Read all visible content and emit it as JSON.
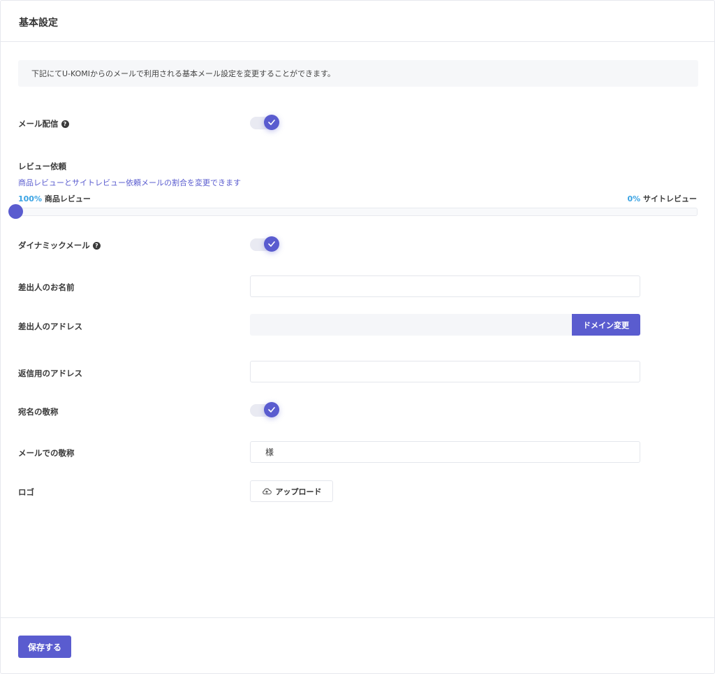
{
  "header": {
    "title": "基本設定"
  },
  "notice": {
    "text": "下記にてU-KOMIからのメールで利用される基本メール設定を変更することができます。"
  },
  "mail_delivery": {
    "label": "メール配信",
    "help_icon": "question-circle-icon",
    "enabled": true
  },
  "review_request": {
    "label": "レビュー依頼",
    "description": "商品レビューとサイトレビュー依頼メールの割合を変更できます",
    "product_percent": "100%",
    "product_label": "商品レビュー",
    "site_percent": "0%",
    "site_label": "サイトレビュー",
    "slider_value": 1.0
  },
  "dynamic_mail": {
    "label": "ダイナミックメール",
    "help_icon": "question-circle-icon",
    "enabled": true
  },
  "sender_name": {
    "label": "差出人のお名前",
    "value": "",
    "placeholder": ""
  },
  "sender_address": {
    "label": "差出人のアドレス",
    "value": "",
    "domain_button": "ドメイン変更"
  },
  "reply_address": {
    "label": "返信用のアドレス",
    "value": "",
    "placeholder": ""
  },
  "honorific_toggle": {
    "label": "宛名の敬称",
    "enabled": true
  },
  "mail_honorific": {
    "label": "メールでの敬称",
    "value": "様"
  },
  "logo": {
    "label": "ロゴ",
    "upload_button": "アップロード",
    "upload_icon": "cloud-upload-icon"
  },
  "footer": {
    "save_button": "保存する"
  },
  "colors": {
    "accent": "#5a5ccf",
    "percent": "#3aa3e3",
    "border": "#e6e8ee"
  }
}
